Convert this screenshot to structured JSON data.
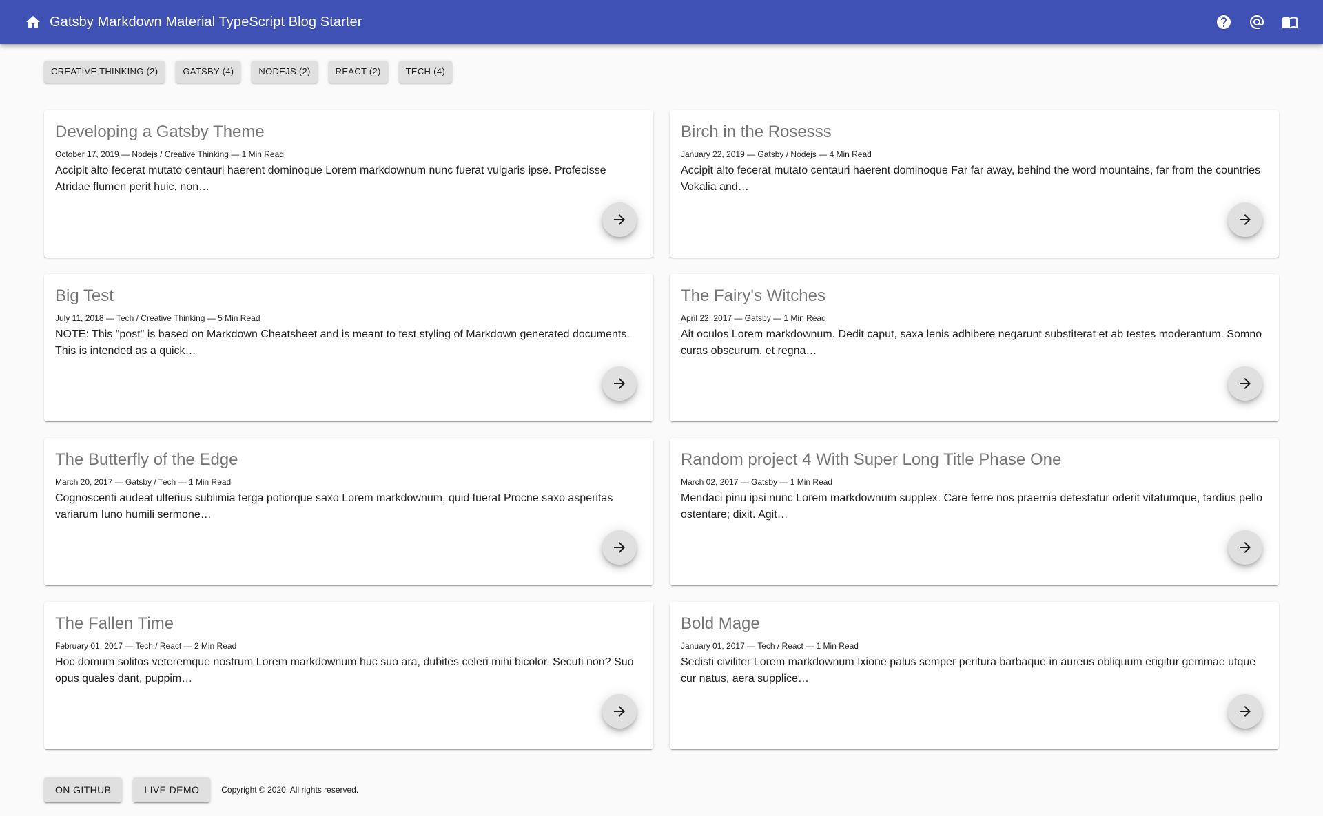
{
  "header": {
    "title": "Gatsby Markdown Material TypeScript Blog Starter",
    "icons": [
      "home-icon",
      "help-icon",
      "at-icon",
      "book-icon"
    ],
    "bar_color": "#3f51b5"
  },
  "tags": [
    {
      "label": "CREATIVE THINKING (2)"
    },
    {
      "label": "GATSBY (4)"
    },
    {
      "label": "NODEJS (2)"
    },
    {
      "label": "REACT (2)"
    },
    {
      "label": "TECH (4)"
    }
  ],
  "posts": [
    {
      "title": "Developing a Gatsby Theme",
      "meta": "October 17, 2019 — Nodejs / Creative Thinking — 1 Min Read",
      "excerpt": "Accipit alto fecerat mutato centauri haerent dominoque Lorem markdownum nunc fuerat vulgaris ipse. Profecisse Atridae flumen perit huic, non…"
    },
    {
      "title": "Birch in the Rosesss",
      "meta": "January 22, 2019 — Gatsby / Nodejs — 4 Min Read",
      "excerpt": "Accipit alto fecerat mutato centauri haerent dominoque Far far away, behind the word mountains, far from the countries Vokalia and…"
    },
    {
      "title": "Big Test",
      "meta": "July 11, 2018 — Tech / Creative Thinking — 5 Min Read",
      "excerpt": "NOTE: This \"post\" is based on Markdown Cheatsheet and is meant to test styling of Markdown generated documents. This is intended as a quick…"
    },
    {
      "title": "The Fairy's Witches",
      "meta": "April 22, 2017 — Gatsby — 1 Min Read",
      "excerpt": "Ait oculos Lorem markdownum. Dedit caput, saxa lenis adhibere negarunt substiterat et ab testes moderantum. Somno curas obscurum, et regna…"
    },
    {
      "title": "The Butterfly of the Edge",
      "meta": "March 20, 2017 — Gatsby / Tech — 1 Min Read",
      "excerpt": "Cognoscenti audeat ulterius sublimia terga potiorque saxo Lorem markdownum, quid fuerat Procne saxo asperitas variarum Iuno humili sermone…"
    },
    {
      "title": "Random project 4 With Super Long Title Phase One",
      "meta": "March 02, 2017 — Gatsby — 1 Min Read",
      "excerpt": "Mendaci pinu ipsi nunc Lorem markdownum supplex. Care ferre nos praemia detestatur oderit vitatumque, tardius pello ostentare; dixit. Agit…"
    },
    {
      "title": "The Fallen Time",
      "meta": "February 01, 2017 — Tech / React — 2 Min Read",
      "excerpt": "Hoc domum solitos veteremque nostrum Lorem markdownum huc suo ara, dubites celeri mihi bicolor. Secuti non? Suo opus quales dant, puppim…"
    },
    {
      "title": "Bold Mage",
      "meta": "January 01, 2017 — Tech / React — 1 Min Read",
      "excerpt": "Sedisti civiliter Lorem markdownum Ixione palus semper peritura barbaque in aureus obliquum erigitur gemmae utque cur natus, aera supplice…"
    }
  ],
  "footer": {
    "github_label": "ON GITHUB",
    "demo_label": "LIVE DEMO",
    "copyright": "Copyright © 2020. All rights reserved."
  }
}
